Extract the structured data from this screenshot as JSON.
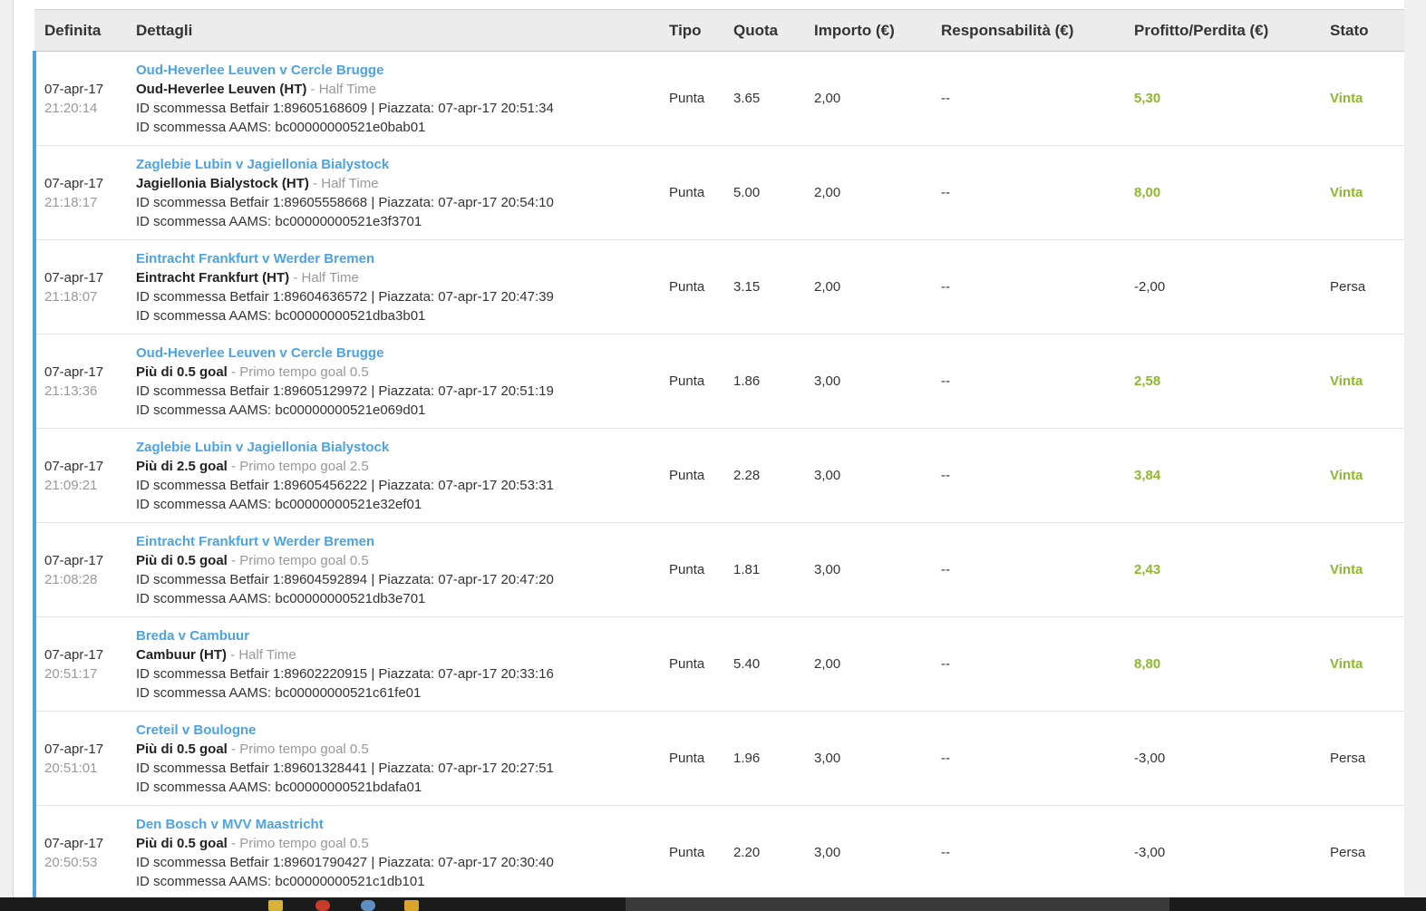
{
  "headers": {
    "definita": "Definita",
    "dettagli": "Dettagli",
    "tipo": "Tipo",
    "quota": "Quota",
    "importo": "Importo (€)",
    "responsabilita": "Responsabilità (€)",
    "profitto": "Profitto/Perdita (€)",
    "stato": "Stato"
  },
  "rows": [
    {
      "date": "07-apr-17",
      "time": "21:20:14",
      "event": "Oud-Heverlee Leuven v Cercle Brugge",
      "selection": "Oud-Heverlee Leuven (HT)",
      "separator": " - ",
      "market": "Half Time",
      "betfair_line": "ID scommessa Betfair 1:89605168609 | Piazzata: 07-apr-17 20:51:34",
      "aams_line": "ID scommessa AAMS: bc00000000521e0bab01",
      "tipo": "Punta",
      "quota": "3.65",
      "importo": "2,00",
      "responsabilita": "--",
      "profitto": "5,30",
      "stato": "Vinta",
      "win": true
    },
    {
      "date": "07-apr-17",
      "time": "21:18:17",
      "event": "Zaglebie Lubin v Jagiellonia Bialystock",
      "selection": "Jagiellonia Bialystock (HT)",
      "separator": " - ",
      "market": "Half Time",
      "betfair_line": "ID scommessa Betfair 1:89605558668 | Piazzata: 07-apr-17 20:54:10",
      "aams_line": "ID scommessa AAMS: bc00000000521e3f3701",
      "tipo": "Punta",
      "quota": "5.00",
      "importo": "2,00",
      "responsabilita": "--",
      "profitto": "8,00",
      "stato": "Vinta",
      "win": true
    },
    {
      "date": "07-apr-17",
      "time": "21:18:07",
      "event": "Eintracht Frankfurt v Werder Bremen",
      "selection": "Eintracht Frankfurt (HT)",
      "separator": " - ",
      "market": "Half Time",
      "betfair_line": "ID scommessa Betfair 1:89604636572 | Piazzata: 07-apr-17 20:47:39",
      "aams_line": "ID scommessa AAMS: bc00000000521dba3b01",
      "tipo": "Punta",
      "quota": "3.15",
      "importo": "2,00",
      "responsabilita": "--",
      "profitto": "-2,00",
      "stato": "Persa",
      "win": false
    },
    {
      "date": "07-apr-17",
      "time": "21:13:36",
      "event": "Oud-Heverlee Leuven v Cercle Brugge",
      "selection": "Più di 0.5 goal",
      "separator": " - ",
      "market": "Primo tempo goal 0.5",
      "betfair_line": "ID scommessa Betfair 1:89605129972 | Piazzata: 07-apr-17 20:51:19",
      "aams_line": "ID scommessa AAMS: bc00000000521e069d01",
      "tipo": "Punta",
      "quota": "1.86",
      "importo": "3,00",
      "responsabilita": "--",
      "profitto": "2,58",
      "stato": "Vinta",
      "win": true
    },
    {
      "date": "07-apr-17",
      "time": "21:09:21",
      "event": "Zaglebie Lubin v Jagiellonia Bialystock",
      "selection": "Più di 2.5 goal",
      "separator": " - ",
      "market": "Primo tempo goal 2.5",
      "betfair_line": "ID scommessa Betfair 1:89605456222 | Piazzata: 07-apr-17 20:53:31",
      "aams_line": "ID scommessa AAMS: bc00000000521e32ef01",
      "tipo": "Punta",
      "quota": "2.28",
      "importo": "3,00",
      "responsabilita": "--",
      "profitto": "3,84",
      "stato": "Vinta",
      "win": true
    },
    {
      "date": "07-apr-17",
      "time": "21:08:28",
      "event": "Eintracht Frankfurt v Werder Bremen",
      "selection": "Più di 0.5 goal",
      "separator": " - ",
      "market": "Primo tempo goal 0.5",
      "betfair_line": "ID scommessa Betfair 1:89604592894 | Piazzata: 07-apr-17 20:47:20",
      "aams_line": "ID scommessa AAMS: bc00000000521db3e701",
      "tipo": "Punta",
      "quota": "1.81",
      "importo": "3,00",
      "responsabilita": "--",
      "profitto": "2,43",
      "stato": "Vinta",
      "win": true
    },
    {
      "date": "07-apr-17",
      "time": "20:51:17",
      "event": "Breda v Cambuur",
      "selection": "Cambuur (HT)",
      "separator": " - ",
      "market": "Half Time",
      "betfair_line": "ID scommessa Betfair 1:89602220915 | Piazzata: 07-apr-17 20:33:16",
      "aams_line": "ID scommessa AAMS: bc00000000521c61fe01",
      "tipo": "Punta",
      "quota": "5.40",
      "importo": "2,00",
      "responsabilita": "--",
      "profitto": "8,80",
      "stato": "Vinta",
      "win": true
    },
    {
      "date": "07-apr-17",
      "time": "20:51:01",
      "event": "Creteil v Boulogne",
      "selection": "Più di 0.5 goal",
      "separator": " - ",
      "market": "Primo tempo goal 0.5",
      "betfair_line": "ID scommessa Betfair 1:89601328441 | Piazzata: 07-apr-17 20:27:51",
      "aams_line": "ID scommessa AAMS: bc00000000521bdafa01",
      "tipo": "Punta",
      "quota": "1.96",
      "importo": "3,00",
      "responsabilita": "--",
      "profitto": "-3,00",
      "stato": "Persa",
      "win": false
    },
    {
      "date": "07-apr-17",
      "time": "20:50:53",
      "event": "Den Bosch v MVV Maastricht",
      "selection": "Più di 0.5 goal",
      "separator": " - ",
      "market": "Primo tempo goal 0.5",
      "betfair_line": "ID scommessa Betfair 1:89601790427 | Piazzata: 07-apr-17 20:30:40",
      "aams_line": "ID scommessa AAMS: bc00000000521c1db101",
      "tipo": "Punta",
      "quota": "2.20",
      "importo": "3,00",
      "responsabilita": "--",
      "profitto": "-3,00",
      "stato": "Persa",
      "win": false
    }
  ],
  "colors": {
    "link_blue": "#4ba3e3",
    "win_green": "#8cb92d",
    "header_bg": "#ececec",
    "row_accent": "#4ba3e3"
  }
}
